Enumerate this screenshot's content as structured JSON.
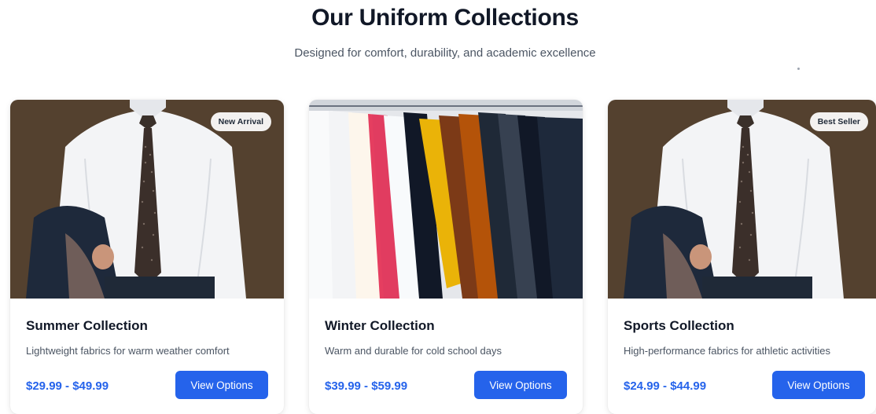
{
  "header": {
    "title": "Our Uniform Collections",
    "subtitle": "Designed for comfort, durability, and academic excellence"
  },
  "collections": [
    {
      "title": "Summer Collection",
      "description": "Lightweight fabrics for warm weather comfort",
      "price": "$29.99 - $49.99",
      "button_label": "View Options",
      "badge": "New Arrival",
      "image": "man-in-white-shirt-and-tie"
    },
    {
      "title": "Winter Collection",
      "description": "Warm and durable for cold school days",
      "price": "$39.99 - $59.99",
      "button_label": "View Options",
      "badge": "",
      "image": "rack-of-colored-shirts"
    },
    {
      "title": "Sports Collection",
      "description": "High-performance fabrics for athletic activities",
      "price": "$24.99 - $44.99",
      "button_label": "View Options",
      "badge": "Best Seller",
      "image": "man-in-white-shirt-and-tie"
    }
  ],
  "colors": {
    "accent": "#2563eb",
    "title": "#111827",
    "muted": "#4b5563"
  }
}
